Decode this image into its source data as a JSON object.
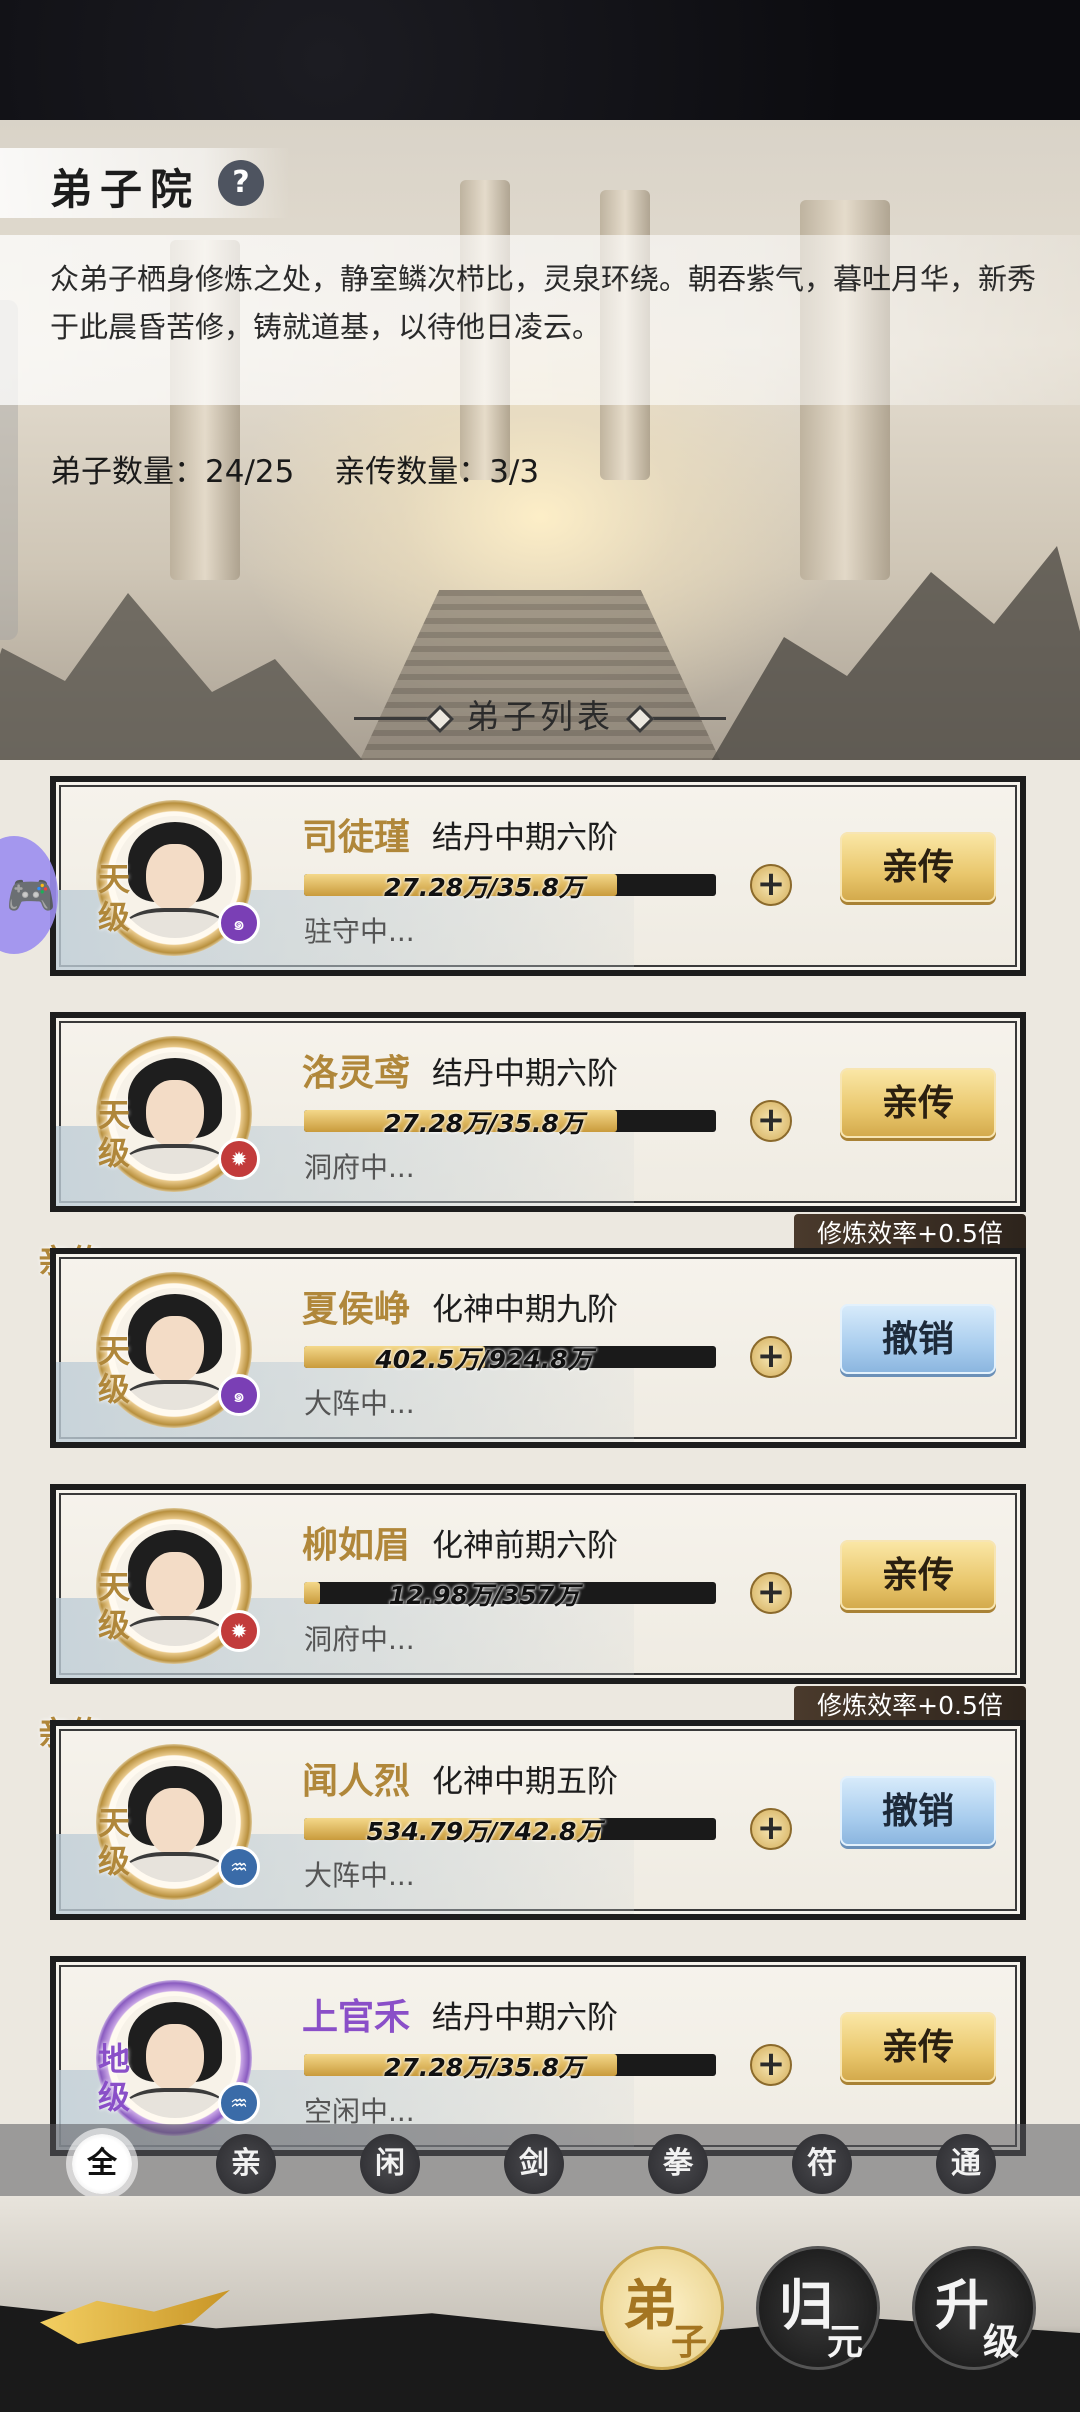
{
  "header": {
    "title": "弟子院",
    "help_icon": "question-icon",
    "description": "众弟子栖身修炼之处，静室鳞次栉比，灵泉环绕。朝吞紫气，暮吐月华，新秀于此晨昏苦修，铸就道基，以待他日凌云。",
    "disciple_count_label": "弟子数量：24/25",
    "inner_count_label": "亲传数量：3/3"
  },
  "list": {
    "title": "弟子列表",
    "disciples": [
      {
        "name": "司徒瑾",
        "realm": "结丹中期六阶",
        "grade": "天级",
        "progress_text": "27.28万/35.8万",
        "progress": 0.76,
        "status": "驻守中...",
        "action": "亲传",
        "element_icon": "swirl-icon",
        "is_inner": false
      },
      {
        "name": "洛灵鸢",
        "realm": "结丹中期六阶",
        "grade": "天级",
        "progress_text": "27.28万/35.8万",
        "progress": 0.76,
        "status": "洞府中...",
        "action": "亲传",
        "element_icon": "fire-icon",
        "is_inner": false
      },
      {
        "name": "夏侯峥",
        "realm": "化神中期九阶",
        "grade": "天级",
        "progress_text": "402.5万/924.8万",
        "progress": 0.44,
        "status": "大阵中...",
        "action": "撤销",
        "element_icon": "swirl-icon",
        "is_inner": true,
        "inner_tag": "亲传",
        "bonus": "修炼效率+0.5倍"
      },
      {
        "name": "柳如眉",
        "realm": "化神前期六阶",
        "grade": "天级",
        "progress_text": "12.98万/357万",
        "progress": 0.04,
        "status": "洞府中...",
        "action": "亲传",
        "element_icon": "fire-icon",
        "is_inner": false
      },
      {
        "name": "闻人烈",
        "realm": "化神中期五阶",
        "grade": "天级",
        "progress_text": "534.79万/742.8万",
        "progress": 0.72,
        "status": "大阵中...",
        "action": "撤销",
        "element_icon": "water-icon",
        "is_inner": true,
        "inner_tag": "亲传",
        "bonus": "修炼效率+0.5倍"
      },
      {
        "name": "上官禾",
        "realm": "结丹中期六阶",
        "grade": "地级",
        "progress_text": "27.28万/35.8万",
        "progress": 0.76,
        "status": "空闲中...",
        "action": "亲传",
        "element_icon": "water-icon",
        "is_inner": false
      }
    ]
  },
  "filters": [
    "全",
    "亲",
    "闲",
    "剑",
    "拳",
    "符",
    "通"
  ],
  "active_filter": 0,
  "nav": [
    {
      "big": "弟",
      "small": "子",
      "active": true
    },
    {
      "big": "归",
      "small": "元",
      "active": false
    },
    {
      "big": "升",
      "small": "级",
      "active": false
    }
  ],
  "colors": {
    "gold_name": "#b0873a",
    "purple_name": "#8a4fc8",
    "gold_button": "#e9c76d",
    "blue_button": "#a9cdee"
  }
}
